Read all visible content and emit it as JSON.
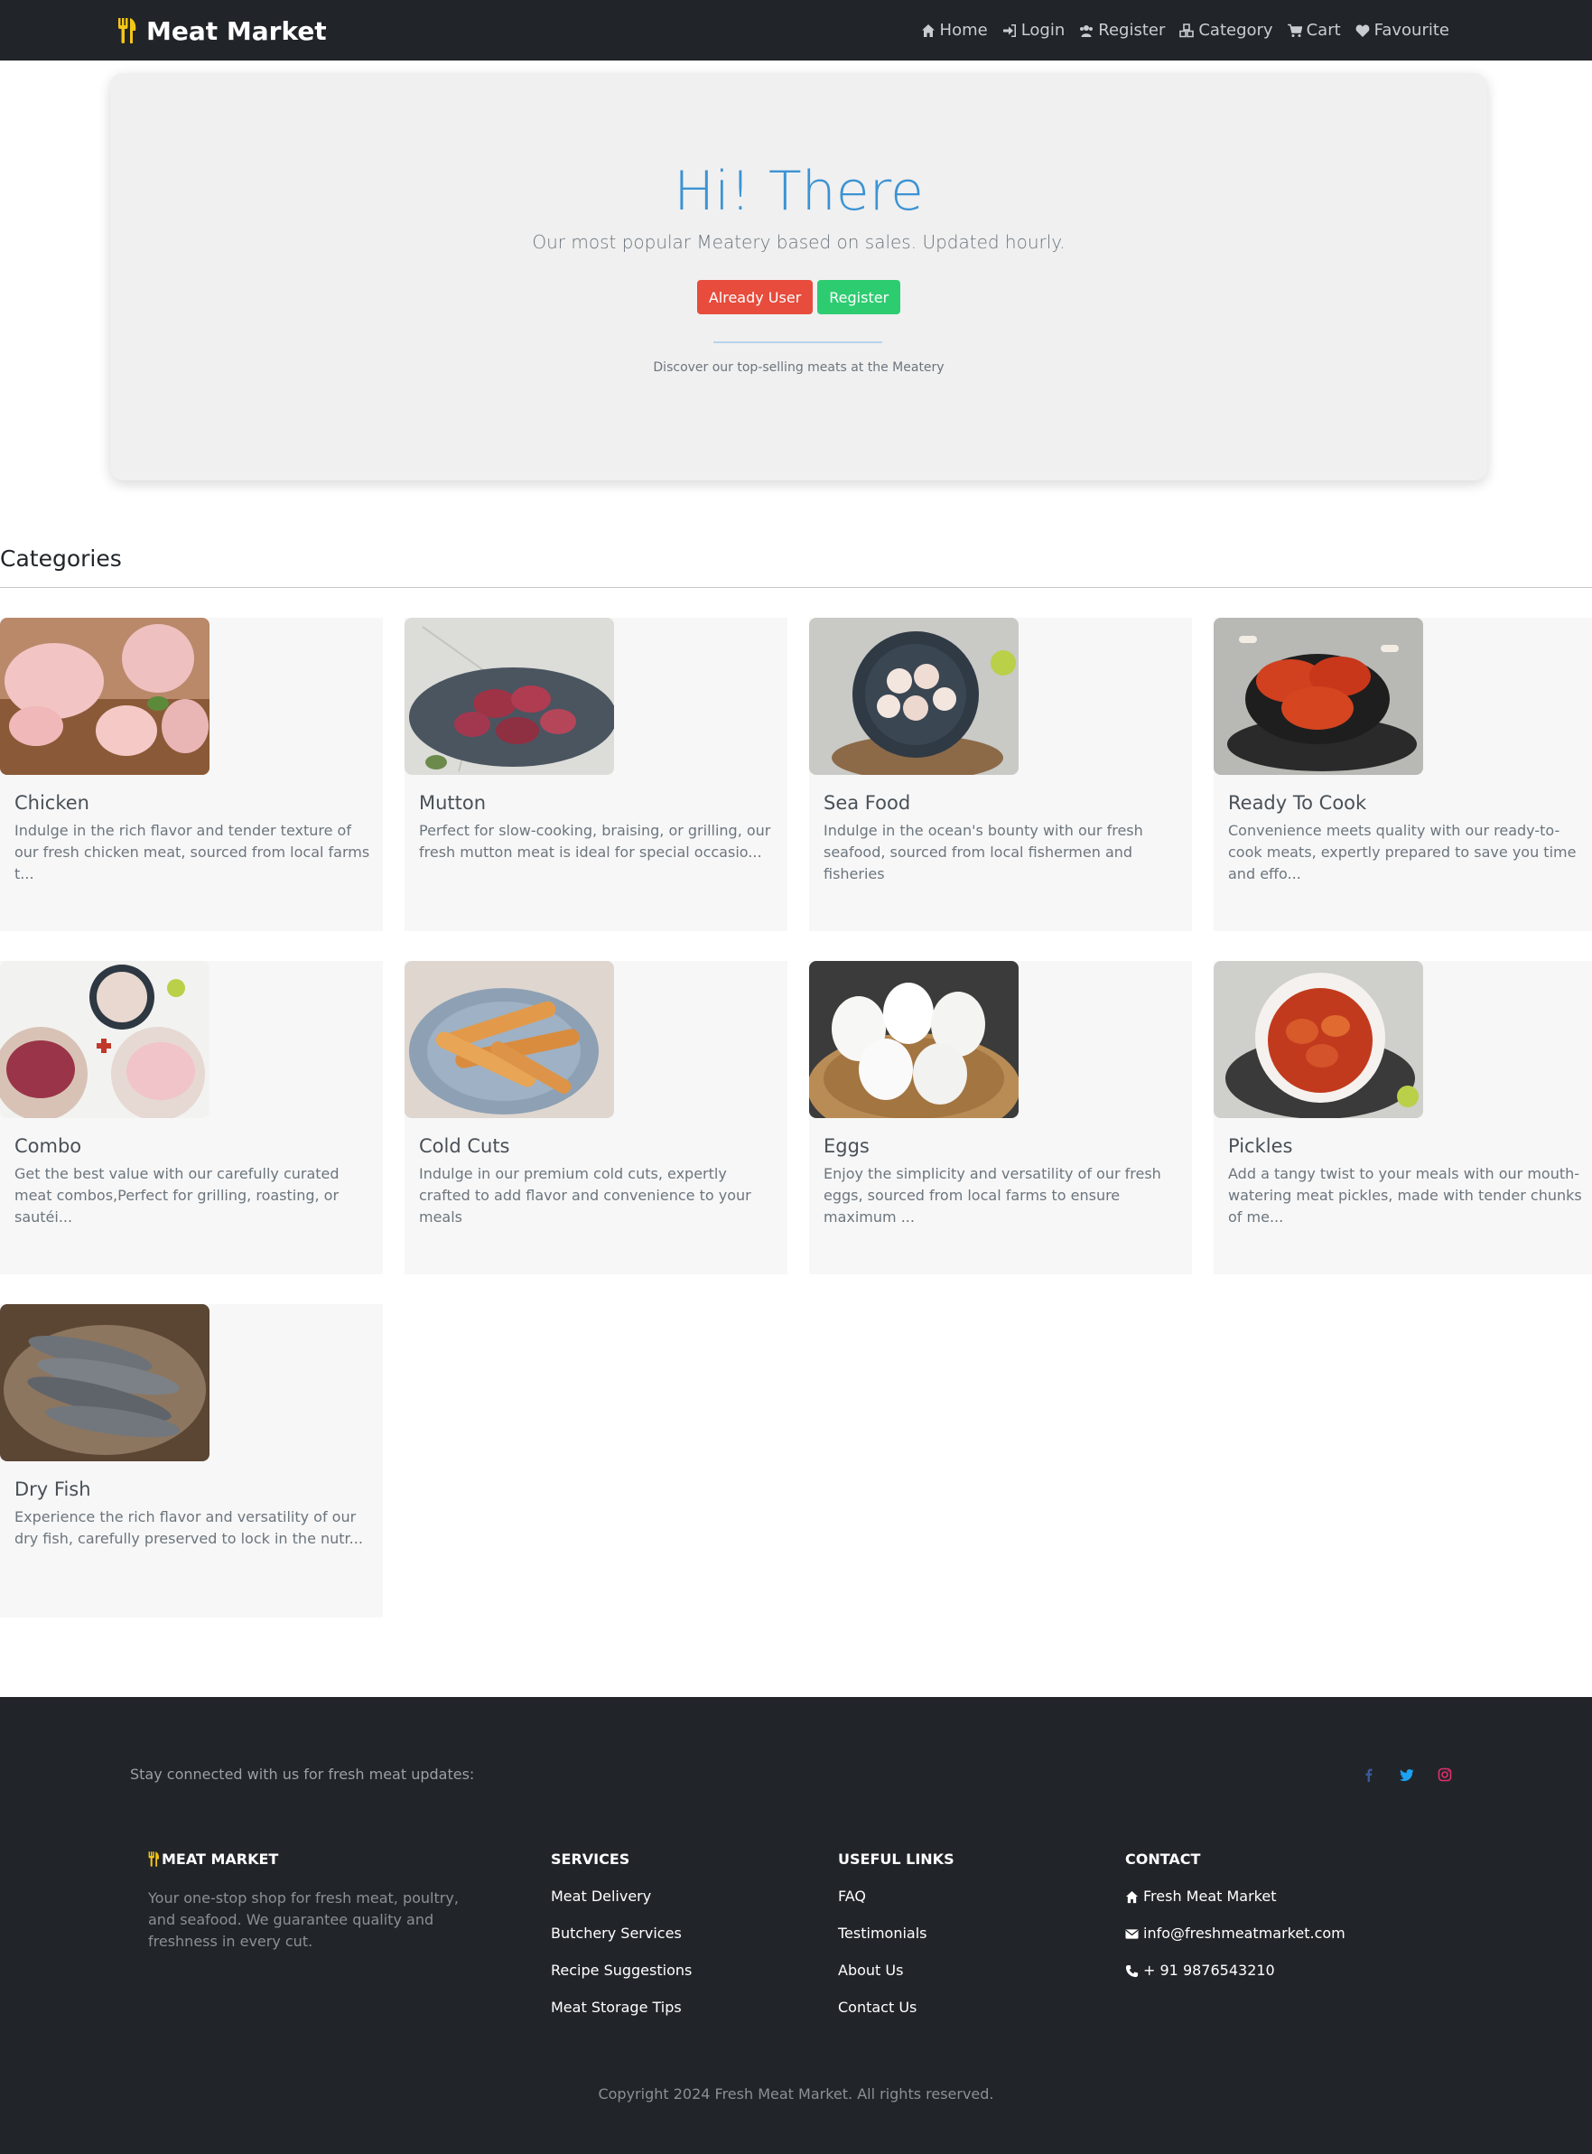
{
  "nav": {
    "brand": "Meat Market",
    "links": [
      {
        "label": "Home",
        "icon": "home-icon"
      },
      {
        "label": "Login",
        "icon": "login-icon"
      },
      {
        "label": "Register",
        "icon": "users-icon"
      },
      {
        "label": "Category",
        "icon": "cubes-icon"
      },
      {
        "label": "Cart",
        "icon": "cart-icon"
      },
      {
        "label": "Favourite",
        "icon": "heart-icon"
      }
    ]
  },
  "hero": {
    "title": "Hi! There",
    "lead": "Our most popular Meatery based on sales. Updated hourly.",
    "already_user_label": "Already User",
    "register_label": "Register",
    "subtext": "Discover our top-selling meats at the Meatery"
  },
  "categories": {
    "heading": "Categories",
    "items": [
      {
        "title": "Chicken",
        "text": "Indulge in the rich flavor and tender texture of our fresh chicken meat, sourced from local farms t..."
      },
      {
        "title": "Mutton",
        "text": "Perfect for slow-cooking, braising, or grilling, our fresh mutton meat is ideal for special occasio..."
      },
      {
        "title": "Sea Food",
        "text": "Indulge in the ocean's bounty with our fresh seafood, sourced from local fishermen and fisheries"
      },
      {
        "title": "Ready To Cook",
        "text": "Convenience meets quality with our ready-to-cook meats, expertly prepared to save you time and effo..."
      },
      {
        "title": "Combo",
        "text": "Get the best value with our carefully curated meat combos,Perfect for grilling, roasting, or sautéi..."
      },
      {
        "title": "Cold Cuts",
        "text": "Indulge in our premium cold cuts, expertly crafted to add flavor and convenience to your meals"
      },
      {
        "title": "Eggs",
        "text": "Enjoy the simplicity and versatility of our fresh eggs, sourced from local farms to ensure maximum ..."
      },
      {
        "title": "Pickles",
        "text": "Add a tangy twist to your meals with our mouth-watering meat pickles, made with tender chunks of me..."
      },
      {
        "title": "Dry Fish",
        "text": "Experience the rich flavor and versatility of our dry fish, carefully preserved to lock in the nutr..."
      }
    ]
  },
  "footer": {
    "stay_connected": "Stay connected with us for fresh meat updates:",
    "social": [
      "facebook-icon",
      "twitter-icon",
      "instagram-icon"
    ],
    "brand_heading": "Meat Market",
    "about": "Your one-stop shop for fresh meat, poultry, and seafood. We guarantee quality and freshness in every cut.",
    "services_heading": "Services",
    "services": [
      "Meat Delivery",
      "Butchery Services",
      "Recipe Suggestions",
      "Meat Storage Tips"
    ],
    "links_heading": "Useful Links",
    "links": [
      "FAQ",
      "Testimonials",
      "About Us",
      "Contact Us"
    ],
    "contact_heading": "Contact",
    "contact": [
      {
        "text": "Fresh Meat Market",
        "icon": "home-icon"
      },
      {
        "text": "info@freshmeatmarket.com",
        "icon": "envelope-icon"
      },
      {
        "text": "+ 91 9876543210",
        "icon": "phone-icon"
      }
    ],
    "copyright": "Copyright 2024 Fresh Meat Market. All rights reserved."
  },
  "colors": {
    "navbar_bg": "#212529",
    "hero_title": "#3b93d3",
    "btn_red": "#e74c3c",
    "btn_green": "#2ecc71",
    "brand_icon": "#f5c518"
  }
}
